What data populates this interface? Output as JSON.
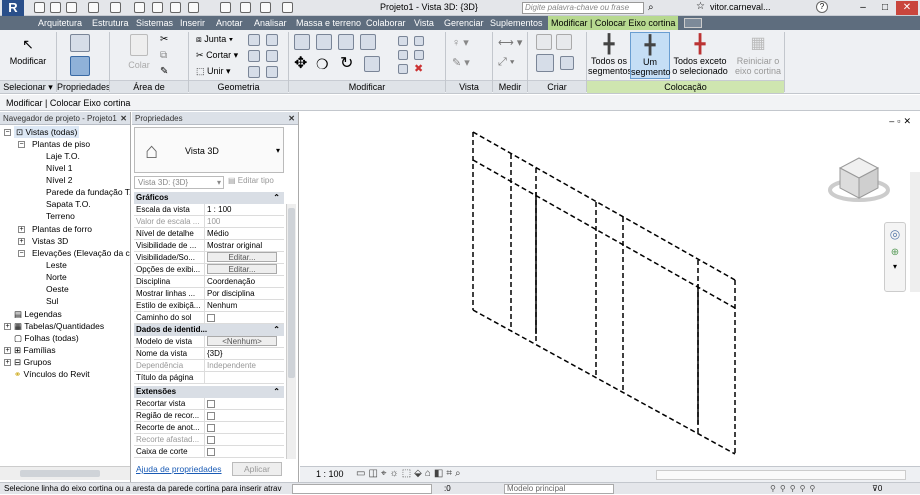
{
  "app": {
    "logo": "R",
    "title": "Projeto1 - Vista 3D: {3D}",
    "search_placeholder": "Digite palavra-chave ou frase",
    "user": "vitor.carneval...",
    "help": "?"
  },
  "tabs": [
    "Arquitetura",
    "Estrutura",
    "Sistemas",
    "Inserir",
    "Anotar",
    "Analisar",
    "Massa e terreno",
    "Colaborar",
    "Vista",
    "Gerenciar",
    "Suplementos",
    "Modificar | Colocar Eixo cortina"
  ],
  "ribbon": {
    "modify_label": "Modificar",
    "clipboard": {
      "colar": "Colar",
      "juntar": "Junta",
      "cortar": "Cortar",
      "unir": "Unir"
    },
    "groups": [
      "Selecionar ▾",
      "Propriedades",
      "Área de transferência",
      "Geometria",
      "Modificar",
      "Vista",
      "Medir",
      "Criar",
      "Colocação"
    ],
    "placement": {
      "all": "Todos os segmentos",
      "one": "Um segmento",
      "all_except": "Todos exceto o selecionado",
      "reinit": "Reiniciar o eixo cortina"
    }
  },
  "options_bar": "Modificar | Colocar Eixo cortina",
  "browser": {
    "title": "Navegador de projeto - Projeto1",
    "items": [
      "Vistas (todas)",
      "Plantas de piso",
      "Laje T.O.",
      "Nível 1",
      "Nível 2",
      "Parede da fundação T.O.",
      "Sapata T.O.",
      "Terreno",
      "Plantas de forro",
      "Vistas 3D",
      "Elevações (Elevação da con",
      "Leste",
      "Norte",
      "Oeste",
      "Sul",
      "Legendas",
      "Tabelas/Quantidades",
      "Folhas (todas)",
      "Famílias",
      "Grupos",
      "Vínculos do Revit"
    ]
  },
  "props": {
    "title": "Propriedades",
    "type": "Vista 3D",
    "selector": "Vista 3D: {3D}",
    "edit_type": "Editar tipo",
    "sections": {
      "graphics": "Gráficos",
      "identity": "Dados de identid...",
      "extents": "Extensões"
    },
    "rows": [
      {
        "k": "Escala da vista",
        "v": "1 : 100"
      },
      {
        "k": "Valor de escala ...",
        "v": "100"
      },
      {
        "k": "Nível de detalhe",
        "v": "Médio"
      },
      {
        "k": "Visibilidade de ...",
        "v": "Mostrar original"
      },
      {
        "k": "Visibilidade/So...",
        "v": "Editar..."
      },
      {
        "k": "Opções de exibi...",
        "v": "Editar..."
      },
      {
        "k": "Disciplina",
        "v": "Coordenação"
      },
      {
        "k": "Mostrar linhas ...",
        "v": "Por disciplina"
      },
      {
        "k": "Estilo de exibiçã...",
        "v": "Nenhum"
      },
      {
        "k": "Caminho do sol",
        "v": ""
      }
    ],
    "id_rows": [
      {
        "k": "Modelo de vista",
        "v": "<Nenhum>"
      },
      {
        "k": "Nome da vista",
        "v": "{3D}"
      },
      {
        "k": "Dependência",
        "v": "Independente"
      },
      {
        "k": "Título da página",
        "v": ""
      }
    ],
    "ext_rows": [
      "Recortar vista",
      "Região de recor...",
      "Recorte de anot...",
      "Recorte afastad...",
      "Caixa de corte"
    ],
    "help_link": "Ajuda de propriedades",
    "apply": "Aplicar"
  },
  "viewbar": {
    "scale": "1 : 100"
  },
  "status": {
    "message": "Selecione linha do eixo cortina ou a aresta da parede cortina para inserir atrav",
    "coord": ":0",
    "model": "Modelo principal",
    "filter": "0"
  },
  "colors": {
    "titlebar": "#e4e6ea",
    "tabbar": "#5e6d7e",
    "context_tab": "#b7d990",
    "ribbon": "#eef0f3"
  }
}
